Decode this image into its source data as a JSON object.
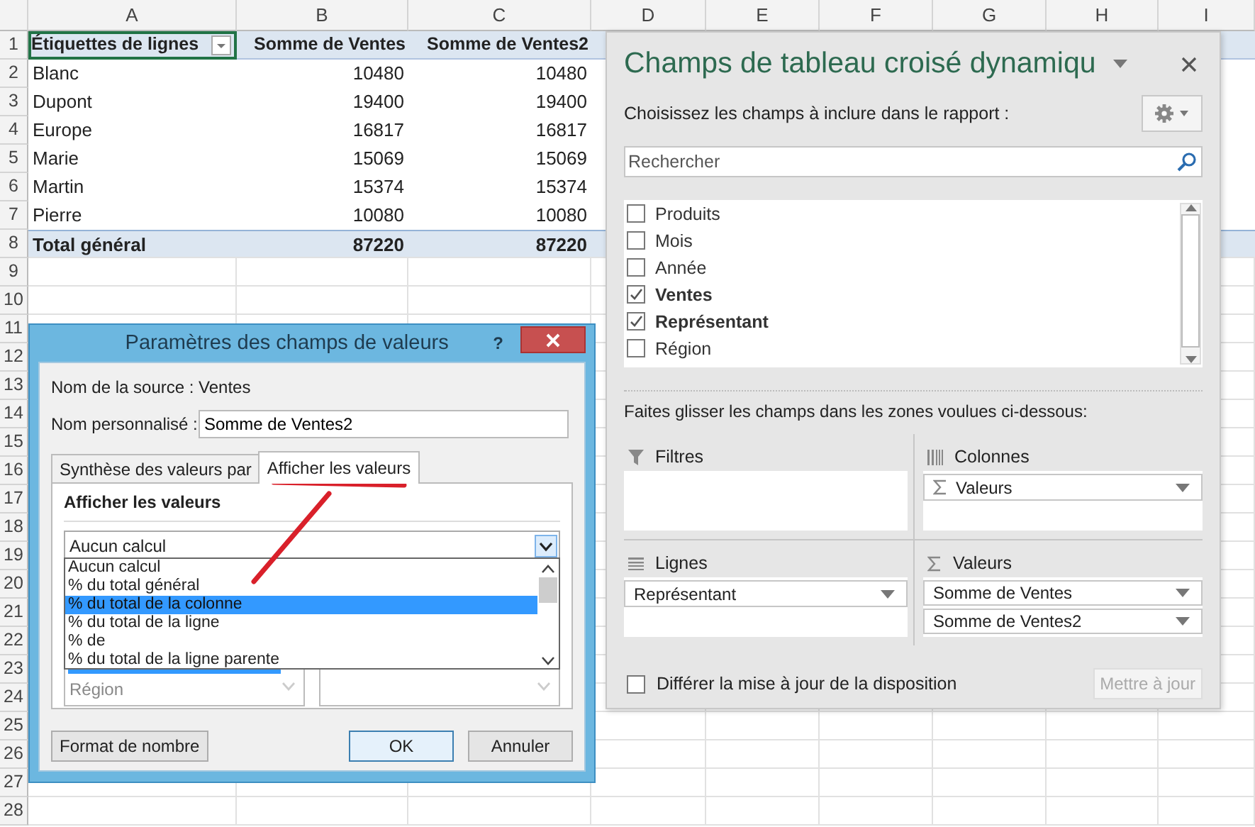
{
  "sheet": {
    "column_headers": [
      "A",
      "B",
      "C",
      "D",
      "E",
      "F",
      "G",
      "H",
      "I"
    ],
    "row_numbers": [
      "1",
      "2",
      "3",
      "4",
      "5",
      "6",
      "7",
      "8",
      "9",
      "10",
      "11",
      "12",
      "13",
      "14",
      "15",
      "16",
      "17",
      "18",
      "19",
      "20",
      "21",
      "22",
      "23",
      "24",
      "25",
      "26",
      "27",
      "28"
    ],
    "pivot": {
      "header": [
        "Étiquettes de lignes",
        "Somme de Ventes",
        "Somme de Ventes2"
      ],
      "rows": [
        [
          "Blanc",
          "10480",
          "10480"
        ],
        [
          "Dupont",
          "19400",
          "19400"
        ],
        [
          "Europe",
          "16817",
          "16817"
        ],
        [
          "Marie",
          "15069",
          "15069"
        ],
        [
          "Martin",
          "15374",
          "15374"
        ],
        [
          "Pierre",
          "10080",
          "10080"
        ]
      ],
      "total": [
        "Total général",
        "87220",
        "87220"
      ]
    }
  },
  "dialog": {
    "title": "Paramètres des champs de valeurs",
    "help": "?",
    "source_label": "Nom de la source :",
    "source_value": "Ventes",
    "custom_label": "Nom personnalisé :",
    "custom_value": "Somme de Ventes2",
    "tabs": [
      {
        "label": "Synthèse des valeurs par",
        "selected": false
      },
      {
        "label": "Afficher les valeurs",
        "selected": true
      }
    ],
    "section_title": "Afficher les valeurs",
    "combo_value": "Aucun calcul",
    "options": [
      {
        "label": "Aucun calcul",
        "selected": false
      },
      {
        "label": "% du total général",
        "selected": false
      },
      {
        "label": "% du total de la colonne",
        "selected": true
      },
      {
        "label": "% du total de la ligne",
        "selected": false
      },
      {
        "label": "% de",
        "selected": false
      },
      {
        "label": "% du total de la ligne parente",
        "selected": false
      }
    ],
    "base_fields": [
      "Région"
    ],
    "buttons": [
      {
        "label": "Format de nombre",
        "kind": "plain"
      },
      {
        "label": "OK",
        "kind": "default"
      },
      {
        "label": "Annuler",
        "kind": "plain"
      }
    ]
  },
  "panel": {
    "title": "Champs de tableau croisé dynamiqu",
    "subtitle": "Choisissez les champs à inclure dans le rapport :",
    "search": {
      "placeholder": "Rechercher"
    },
    "fields": [
      {
        "label": "Produits",
        "checked": false
      },
      {
        "label": "Mois",
        "checked": false
      },
      {
        "label": "Année",
        "checked": false
      },
      {
        "label": "Ventes",
        "checked": true
      },
      {
        "label": "Représentant",
        "checked": true
      },
      {
        "label": "Région",
        "checked": false
      }
    ],
    "instruction": "Faites glisser les champs dans les zones voulues ci-dessous:",
    "areas": [
      {
        "kind": "filter",
        "title": "Filtres"
      },
      {
        "kind": "columns",
        "title": "Colonnes",
        "items": [
          {
            "label": "Valeurs",
            "kind": "values"
          }
        ]
      },
      {
        "kind": "rows",
        "title": "Lignes",
        "items": [
          {
            "label": "Représentant",
            "kind": "field"
          }
        ]
      },
      {
        "kind": "values",
        "title": "Valeurs",
        "items": [
          {
            "label": "Somme de Ventes",
            "kind": "field"
          },
          {
            "label": "Somme de Ventes2",
            "kind": "field"
          }
        ]
      }
    ],
    "defer": {
      "label": "Différer la mise à jour de la disposition",
      "checked": false
    },
    "update_button": {
      "label": "Mettre à jour",
      "disabled": true
    }
  }
}
